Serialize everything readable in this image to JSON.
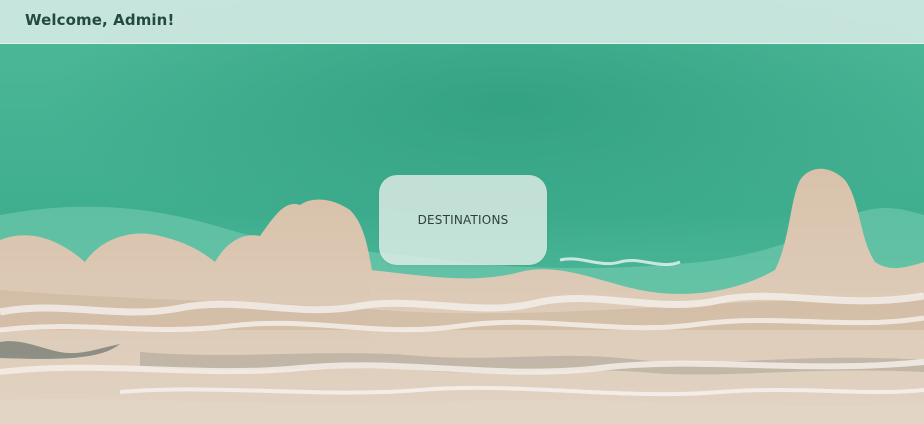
{
  "header": {
    "welcome_text": "Welcome, Admin!"
  },
  "main": {
    "destinations_label": "DESTINATIONS"
  },
  "background": {
    "description_icon": "beach-aerial-image",
    "colors": {
      "sea_deep": "#3fae8f",
      "sea_light": "#5ec2a3",
      "sand": "#d9c4ae",
      "foam": "#f1ece6"
    }
  }
}
